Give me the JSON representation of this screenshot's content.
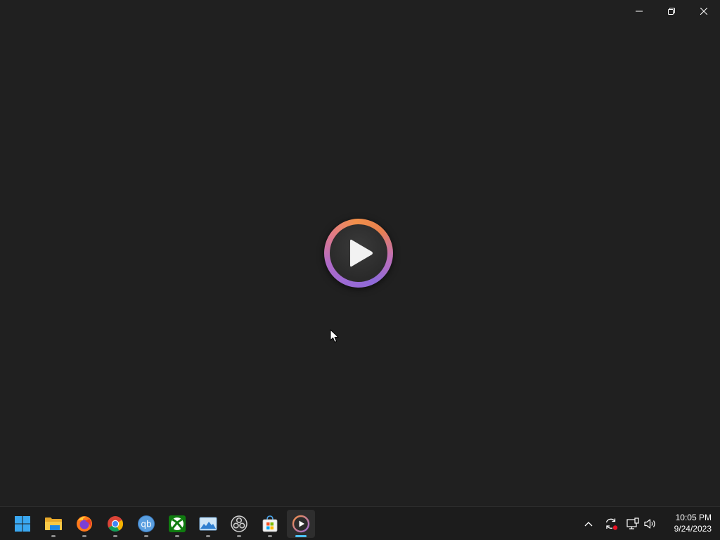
{
  "window": {
    "caption_buttons": [
      {
        "name": "minimize",
        "icon": "minimize-icon"
      },
      {
        "name": "restore",
        "icon": "restore-icon"
      },
      {
        "name": "close",
        "icon": "close-icon"
      }
    ],
    "splash_icon": "media-player-logo-icon"
  },
  "taskbar": {
    "apps": [
      {
        "name": "start",
        "icon": "windows-start-icon"
      },
      {
        "name": "file-explorer",
        "icon": "folder-icon"
      },
      {
        "name": "firefox",
        "icon": "firefox-icon"
      },
      {
        "name": "chrome",
        "icon": "chrome-icon"
      },
      {
        "name": "qbittorrent",
        "icon": "qbittorrent-icon",
        "label": "qb"
      },
      {
        "name": "xbox",
        "icon": "xbox-icon"
      },
      {
        "name": "photos",
        "icon": "photos-icon"
      },
      {
        "name": "obs",
        "icon": "obs-icon"
      },
      {
        "name": "store",
        "icon": "store-icon"
      },
      {
        "name": "media-player",
        "icon": "media-player-icon",
        "active": true
      }
    ],
    "tray": {
      "icons": [
        "chevron-up-icon",
        "sync-icon",
        "network-icon",
        "volume-icon"
      ]
    },
    "clock": {
      "time": "10:05 PM",
      "date": "9/24/2023"
    }
  },
  "colors": {
    "background": "#202020",
    "taskbar": "#1c1c1c",
    "accent": "#4cc2ff",
    "logo_orange": "#f2904a",
    "logo_purple": "#9b6bd6"
  }
}
